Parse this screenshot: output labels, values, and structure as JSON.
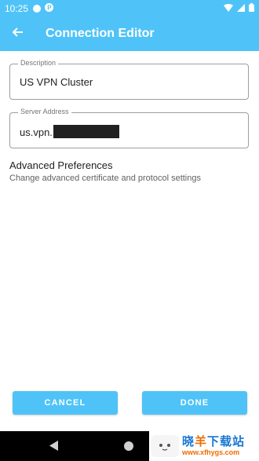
{
  "status_bar": {
    "time": "10:25",
    "left_icons": [
      "notification-circle-icon",
      "vpn-p-icon"
    ],
    "right_icons": [
      "wifi-icon",
      "cellular-icon",
      "battery-icon"
    ]
  },
  "app_bar": {
    "title": "Connection Editor",
    "back_icon": "arrow-left-icon"
  },
  "form": {
    "description": {
      "label": "Description",
      "value": "US VPN Cluster"
    },
    "server_address": {
      "label": "Server Address",
      "value": "us.vpn."
    }
  },
  "advanced": {
    "title": "Advanced Preferences",
    "subtitle": "Change advanced certificate and protocol settings"
  },
  "buttons": {
    "cancel": "CANCEL",
    "done": "DONE"
  },
  "nav_bar": {
    "icons": [
      "nav-back-icon",
      "nav-home-icon",
      "nav-recents-icon"
    ]
  },
  "watermark": {
    "text_blue_1": "晓",
    "text_orange": "羊",
    "text_blue_2": "下载站",
    "url": "www.xfhygs.com"
  },
  "colors": {
    "accent": "#4fc3f7",
    "text_primary": "#212121",
    "text_secondary": "#616161",
    "outline": "#9e9e9e"
  }
}
